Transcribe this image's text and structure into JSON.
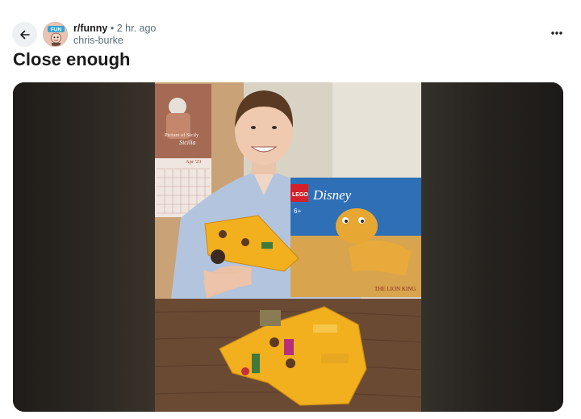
{
  "post": {
    "subreddit": "r/funny",
    "separator": "•",
    "time_ago": "2 hr. ago",
    "author": "chris-burke",
    "title": "Close enough"
  },
  "avatar": {
    "text": "FUN"
  },
  "image_text": {
    "calendar_title": "Picture of Sicily",
    "calendar_caption": "Sicilia",
    "calendar_month": "Apr '23",
    "box_brand_1": "LEGO",
    "box_brand_2": "Disney",
    "box_age": "6+",
    "box_subtitle": "THE LION KING"
  },
  "icons": {
    "back": "arrow-left-icon",
    "more": "more-horizontal-icon"
  },
  "colors": {
    "accent_bg": "#eef1f3",
    "muted_text": "#576f76",
    "lego_yellow": "#f2b01e",
    "wood_table": "#6b4a34"
  }
}
